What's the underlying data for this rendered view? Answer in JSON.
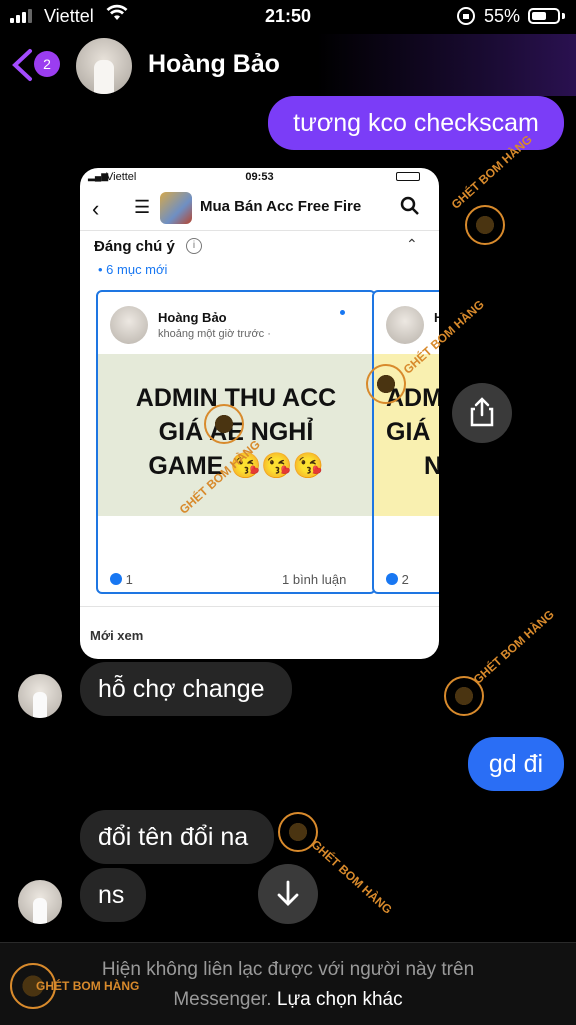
{
  "status": {
    "carrier": "Viettel",
    "time": "21:50",
    "battery": "55%"
  },
  "header": {
    "name": "Hoàng Bảo",
    "badge": "2"
  },
  "messages": {
    "m1": "tương kco checkscam",
    "m2": "hỗ chợ change",
    "m3": "gd đi",
    "m4": "đổi tên đổi na",
    "m5": "ns"
  },
  "shared": {
    "carrier": "Viettel",
    "time": "09:53",
    "group": "Mua Bán Acc Free Fire",
    "notable": "Đáng chú ý",
    "new_count": "• 6 mục mới",
    "card1": {
      "author": "Hoàng Bảo",
      "time": "khoảng một giờ trước ·",
      "line1": "ADMIN THU ACC",
      "line2": "GIÁ AE NGHỈ",
      "line3": "GAME 😘😘😘",
      "likes": "1",
      "comments": "1 bình luận"
    },
    "card2": {
      "author": "H",
      "line1": "ADM",
      "line2": "GIÁ",
      "line3": "N",
      "likes": "2"
    },
    "recent": "Mới xem"
  },
  "watermark": {
    "text_a": "GHÉT",
    "text_b": "BOM HÀNG"
  },
  "footer": {
    "line1": "Hiện không liên lạc được với người này trên",
    "line2a": "Messenger.",
    "line2b": "Lựa chọn khác"
  },
  "icons": [
    "back-chevron-icon",
    "share-icon",
    "scroll-down-icon",
    "search-icon",
    "menu-icon",
    "like-icon"
  ]
}
